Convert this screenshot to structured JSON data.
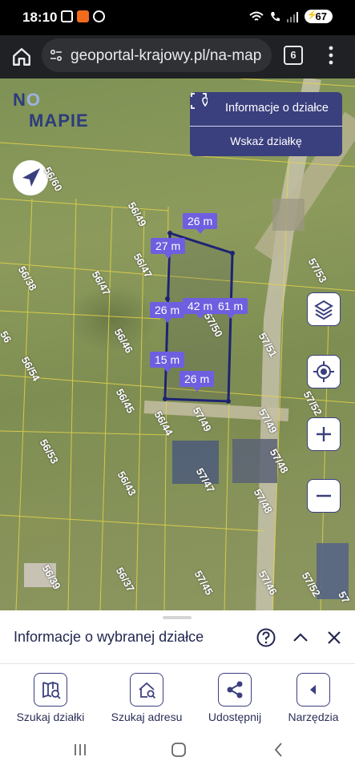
{
  "status": {
    "time": "18:10",
    "battery": "67"
  },
  "browser": {
    "url": "geoportal-krajowy.pl/na-map",
    "tab_count": "6"
  },
  "map": {
    "logo_part1": "N",
    "logo_part2": "O",
    "logo_part3": "MAPIE",
    "info_panel": {
      "title": "Informacje o działce",
      "action": "Wskaż działkę"
    },
    "parcels": [
      "56/60",
      "56/49",
      "56/47",
      "56/38",
      "56/47",
      "56/46",
      "56/54",
      "56/45",
      "56/44",
      "56/53",
      "56/43",
      "56/39",
      "56/37",
      "57/50",
      "57/53",
      "57/51",
      "57/52",
      "57/49",
      "57/49",
      "57/48",
      "57/47",
      "57/48",
      "57/45",
      "57/46",
      "57/52",
      "56",
      "57"
    ],
    "dimensions": [
      "26 m",
      "27 m",
      "42 m",
      "61 m",
      "26 m",
      "15 m",
      "26 m"
    ]
  },
  "sheet": {
    "title": "Informacje o wybranej działce",
    "tools": [
      {
        "label": "Szukaj działki"
      },
      {
        "label": "Szukaj adresu"
      },
      {
        "label": "Udostępnij"
      },
      {
        "label": "Narzędzia"
      }
    ]
  },
  "colors": {
    "accent": "#3a3f7e",
    "dimension": "#6e5fe0",
    "parcel_outline": "#1e2372"
  }
}
